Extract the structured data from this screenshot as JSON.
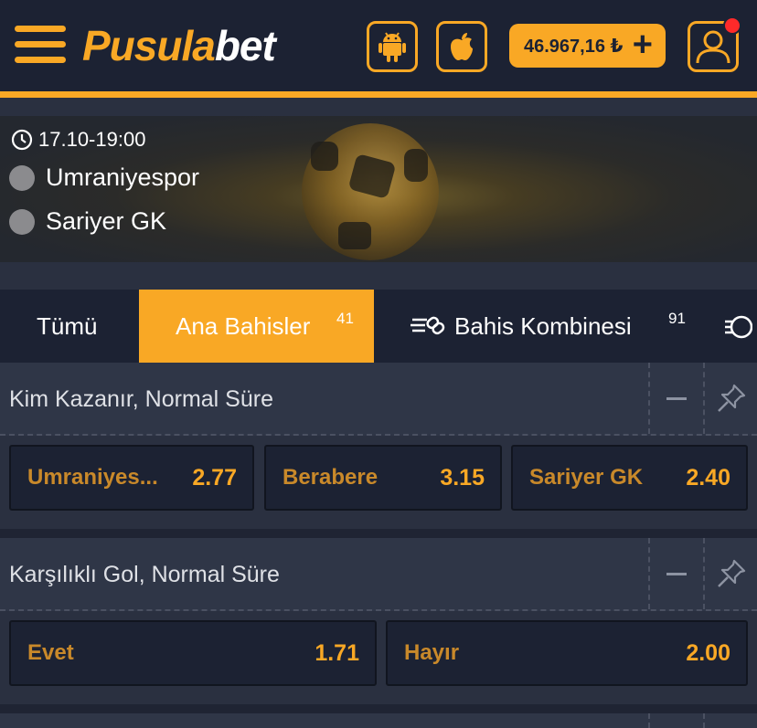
{
  "header": {
    "logo_part1": "Pusula",
    "logo_part2": "bet",
    "balance": "46.967,16 ₺",
    "icons": [
      "hamburger-menu-icon",
      "android-icon",
      "apple-icon",
      "plus-icon",
      "user-icon"
    ],
    "accent_color": "#f9a825",
    "notification_color": "#ff2a2a"
  },
  "match": {
    "datetime": "17.10-19:00",
    "team_home": "Umraniyespor",
    "team_away": "Sariyer GK"
  },
  "tabs": [
    {
      "label": "Tümü",
      "count": ""
    },
    {
      "label": "Ana Bahisler",
      "count": "41",
      "active": true
    },
    {
      "label": "Bahis Kombinesi",
      "count": "91",
      "icon": "bet-builder-icon"
    }
  ],
  "markets": [
    {
      "title": "Kim Kazanır, Normal Süre",
      "odds": [
        {
          "name": "Umraniyes...",
          "value": "2.77"
        },
        {
          "name": "Berabere",
          "value": "3.15"
        },
        {
          "name": "Sariyer GK",
          "value": "2.40"
        }
      ]
    },
    {
      "title": "Karşılıklı Gol, Normal Süre",
      "odds": [
        {
          "name": "Evet",
          "value": "1.71"
        },
        {
          "name": "Hayır",
          "value": "2.00"
        }
      ]
    }
  ]
}
